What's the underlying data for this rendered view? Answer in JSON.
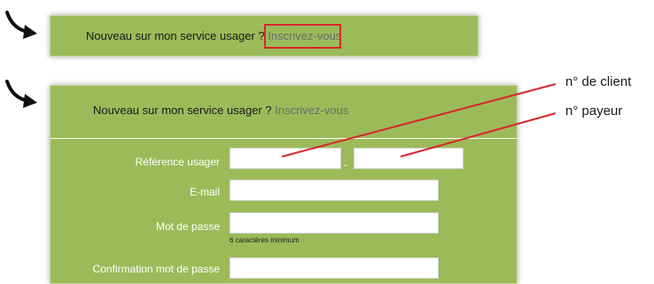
{
  "banner": {
    "text": "Nouveau sur mon service usager ?",
    "link": "Inscrivez-vous"
  },
  "form": {
    "header_text": "Nouveau sur mon service usager ?",
    "header_link": "Inscrivez-vous",
    "reference_label": "Référence usager",
    "separator": "-",
    "email_label": "E-mail",
    "password_label": "Mot de passe",
    "password_hint": "6 caractères minimum",
    "confirm_label": "Confirmation mot de passe",
    "reference_client_value": "",
    "reference_payeur_value": "",
    "email_value": "",
    "password_value": "",
    "confirm_value": ""
  },
  "annotations": {
    "client": "n° de client",
    "payeur": "n° payeur"
  },
  "colors": {
    "panel_green": "#9bbb59",
    "highlight_red": "#d9262b"
  },
  "icons": [
    "curved-arrow-icon",
    "curved-arrow-icon"
  ]
}
